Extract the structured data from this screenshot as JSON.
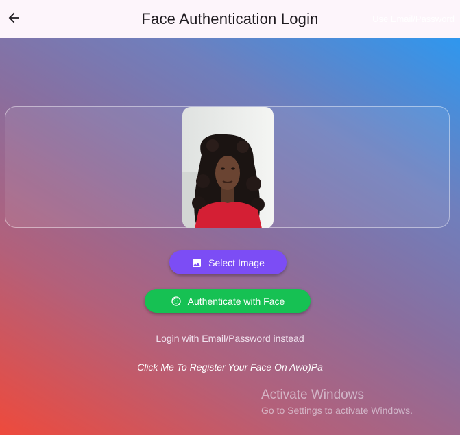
{
  "appbar": {
    "title": "Face Authentication Login",
    "action_label": "Use Email/Password"
  },
  "buttons": {
    "select_image": "Select Image",
    "authenticate": "Authenticate with Face"
  },
  "links": {
    "email_login": "Login with Email/Password instead",
    "register": "Click Me To Register Your Face On Awo)Pa"
  },
  "watermark": {
    "title": "Activate Windows",
    "subtitle": "Go to Settings to activate Windows."
  },
  "icons": {
    "back": "arrow-back-icon",
    "image": "image-icon",
    "face": "face-icon"
  },
  "colors": {
    "appbar_bg": "#fdf5fb",
    "select_button": "#7c4df5",
    "auth_button": "#16c153",
    "gradient_start": "#ee4a3c",
    "gradient_end": "#2f97ee"
  }
}
